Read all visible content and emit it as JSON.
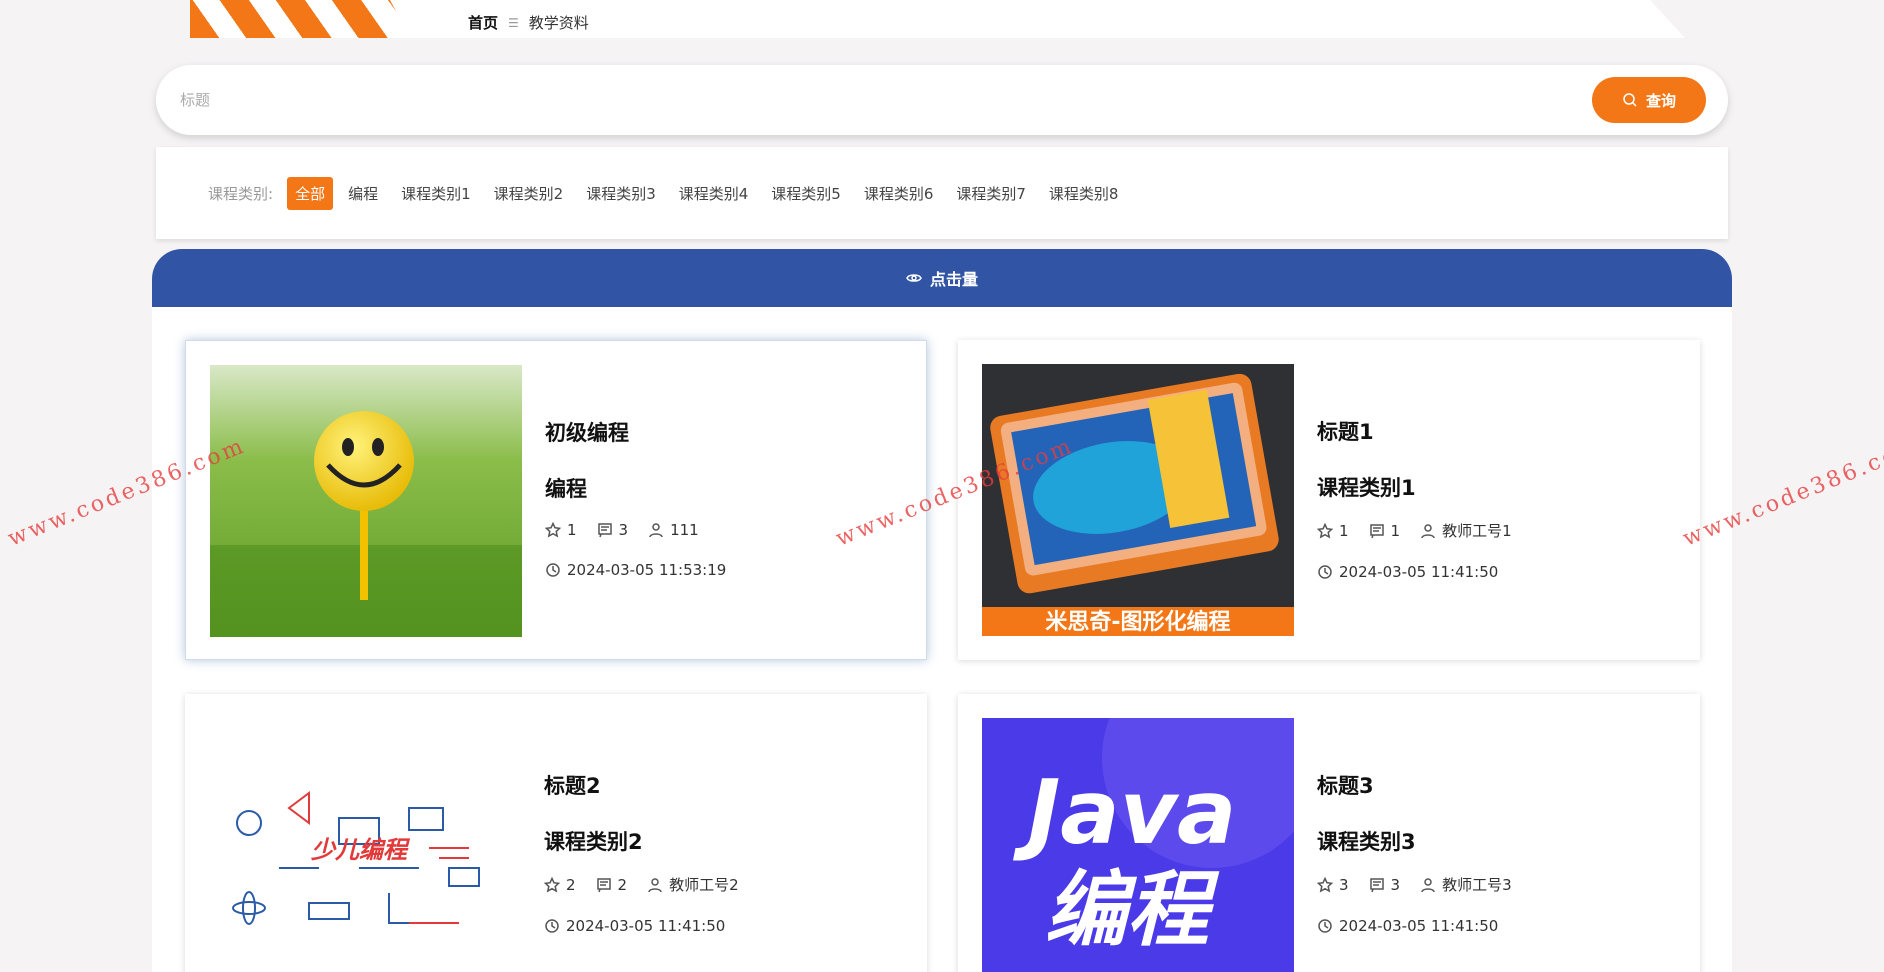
{
  "breadcrumb": {
    "home": "首页",
    "separator": "☰",
    "current": "教学资料"
  },
  "search": {
    "placeholder": "标题",
    "button_label": "查询"
  },
  "filter": {
    "label": "课程类别:",
    "categories": [
      "全部",
      "编程",
      "课程类别1",
      "课程类别2",
      "课程类别3",
      "课程类别4",
      "课程类别5",
      "课程类别6",
      "课程类别7",
      "课程类别8"
    ],
    "active": "全部"
  },
  "sort": {
    "label": "点击量"
  },
  "cards": [
    {
      "title": "初级编程",
      "category": "编程",
      "stars": "1",
      "comments": "3",
      "author": "111",
      "time": "2024-03-05 11:53:19",
      "image": "smiley-golf-ball"
    },
    {
      "title": "标题1",
      "category": "课程类别1",
      "stars": "1",
      "comments": "1",
      "author": "教师工号1",
      "time": "2024-03-05 11:41:50",
      "image": "scratch-kit-box",
      "image_caption": "米思奇-图形化编程"
    },
    {
      "title": "标题2",
      "category": "课程类别2",
      "stars": "2",
      "comments": "2",
      "author": "教师工号2",
      "time": "2024-03-05 11:41:50",
      "image": "kids-coding-icons",
      "image_caption": "少儿编程"
    },
    {
      "title": "标题3",
      "category": "课程类别3",
      "stars": "3",
      "comments": "3",
      "author": "教师工号3",
      "time": "2024-03-05 11:41:50",
      "image": "java-banner",
      "image_caption_line1": "Java",
      "image_caption_line2": "编程"
    }
  ],
  "watermark": "www.code386.com",
  "colors": {
    "accent": "#f37617",
    "sortbar": "#3155a4",
    "page_bg": "#f5f3f4"
  }
}
